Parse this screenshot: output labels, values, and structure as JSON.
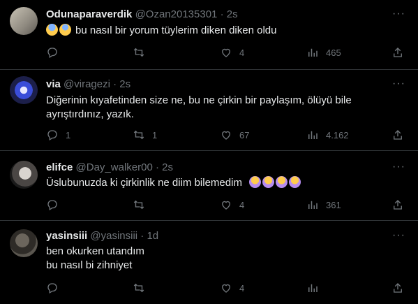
{
  "tweets": [
    {
      "display_name": "Odunaparaverdik",
      "handle": "@Ozan20135301",
      "time": "2s",
      "emoji_prefix": [
        "anxious-face-emoji",
        "scream-face-emoji"
      ],
      "lines": [
        "bu nasıl bir yorum tüylerim diken diken oldu"
      ],
      "replies": "",
      "retweets": "",
      "likes": "4",
      "views": "465"
    },
    {
      "display_name": "via",
      "handle": "@viragezi",
      "time": "2s",
      "lines": [
        "Diğerinin kıyafetinden size ne, bu ne çirkin bir paylaşım, ölüyü bile",
        "ayrıştırdınız, yazık."
      ],
      "replies": "1",
      "retweets": "1",
      "likes": "67",
      "views": "4.162"
    },
    {
      "display_name": "elifce",
      "handle": "@Day_walker00",
      "time": "2s",
      "lines": [
        "Üslubunuzda ki çirkinlik ne diim bilemedim"
      ],
      "emoji_suffix": [
        "facepalm-emoji",
        "facepalm-emoji",
        "facepalm-emoji",
        "facepalm-emoji"
      ],
      "replies": "",
      "retweets": "",
      "likes": "4",
      "views": "361"
    },
    {
      "display_name": "yasinsiii",
      "handle": "@yasinsiii",
      "time": "1d",
      "lines": [
        "ben okurken utandım",
        "bu nasıl bi zihniyet"
      ],
      "replies": "",
      "retweets": "",
      "likes": "4",
      "views": ""
    }
  ],
  "separator": "·",
  "more_symbol": "···",
  "colors": {
    "background": "#000000",
    "text": "#e7e9ea",
    "muted": "#71767b",
    "border": "#2f3336"
  }
}
